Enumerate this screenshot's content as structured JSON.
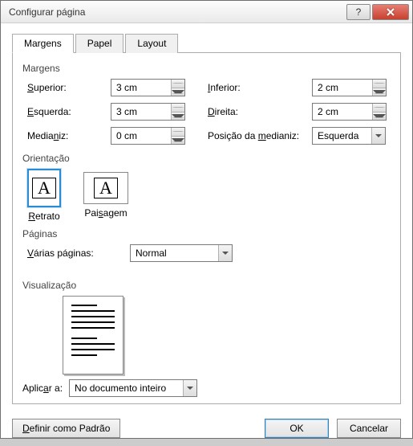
{
  "title": "Configurar página",
  "tabs": {
    "margens": "Margens",
    "papel": "Papel",
    "layout": "Layout"
  },
  "margens": {
    "group": "Margens",
    "superior_label": "Superior:",
    "superior": "3 cm",
    "inferior_label": "Inferior:",
    "inferior": "2 cm",
    "esquerda_label": "Esquerda:",
    "esquerda": "3 cm",
    "direita_label": "Direita:",
    "direita": "2 cm",
    "medianiz_label": "Medianiz:",
    "medianiz": "0 cm",
    "pos_medianiz_label": "Posição da medianiz:",
    "pos_medianiz": "Esquerda"
  },
  "orientacao": {
    "group": "Orientação",
    "retrato": "Retrato",
    "paisagem": "Paisagem"
  },
  "paginas": {
    "group": "Páginas",
    "varias_label": "Várias páginas:",
    "varias": "Normal"
  },
  "visualizacao": {
    "group": "Visualização"
  },
  "aplicar": {
    "label": "Aplicar a:",
    "value": "No documento inteiro"
  },
  "footer": {
    "default": "Definir como Padrão",
    "ok": "OK",
    "cancel": "Cancelar"
  }
}
